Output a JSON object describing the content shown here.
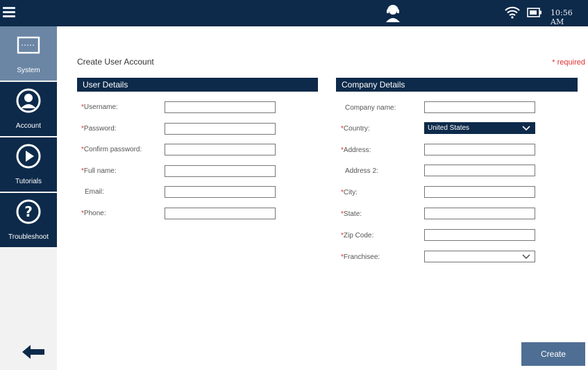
{
  "status_bar": {
    "time": "10:56 AM"
  },
  "sidebar": {
    "items": [
      {
        "label": "System",
        "icon": "monitor-icon"
      },
      {
        "label": "Account",
        "icon": "account-icon"
      },
      {
        "label": "Tutorials",
        "icon": "play-icon"
      },
      {
        "label": "Troubleshoot",
        "icon": "help-icon"
      }
    ]
  },
  "page": {
    "title": "Create User Account",
    "required_note": "* required"
  },
  "user_details": {
    "header": "User Details",
    "fields": [
      {
        "label": "Username:",
        "required": true,
        "value": ""
      },
      {
        "label": "Password:",
        "required": true,
        "value": ""
      },
      {
        "label": "Confirm password:",
        "required": true,
        "value": ""
      },
      {
        "label": "Full name:",
        "required": true,
        "value": ""
      },
      {
        "label": "Email:",
        "required": false,
        "value": ""
      },
      {
        "label": "Phone:",
        "required": true,
        "value": ""
      }
    ]
  },
  "company_details": {
    "header": "Company Details",
    "fields": [
      {
        "label": "Company name:",
        "required": false,
        "value": ""
      },
      {
        "label": "Country:",
        "required": true,
        "value": "United States"
      },
      {
        "label": "Address:",
        "required": true,
        "value": ""
      },
      {
        "label": "Address 2:",
        "required": false,
        "value": ""
      },
      {
        "label": "City:",
        "required": true,
        "value": ""
      },
      {
        "label": "State:",
        "required": true,
        "value": ""
      },
      {
        "label": "Zip Code:",
        "required": true,
        "value": ""
      },
      {
        "label": "Franchisee:",
        "required": true,
        "value": ""
      }
    ]
  },
  "actions": {
    "create_label": "Create"
  },
  "colors": {
    "navy": "#0d2a4a",
    "active_nav": "#6b86a5",
    "button": "#4f6e93",
    "required": "#e03030"
  }
}
